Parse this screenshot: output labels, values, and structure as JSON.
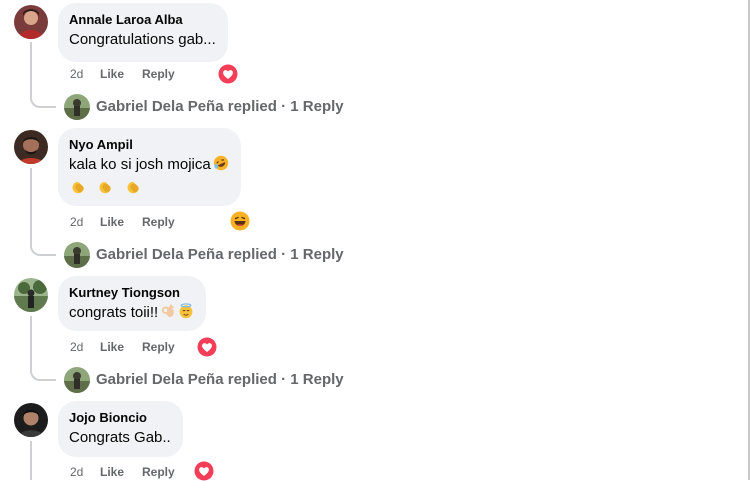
{
  "comments": [
    {
      "author": "Annale Laroa Alba",
      "text": "Congratulations gab...",
      "time": "2d",
      "like_label": "Like",
      "reply_label": "Reply",
      "reaction_icon": "heart-reaction-icon",
      "replies": {
        "author": "Gabriel Dela Peña",
        "replied_label": "replied",
        "separator": "·",
        "count_label": "1 Reply"
      }
    },
    {
      "author": "Nyo Ampil",
      "text": "kala ko si josh mojica",
      "text_emoji_icon": "rolling-laughing-emoji-icon",
      "emoji_line_icons": [
        "clapping-hands-icon",
        "clapping-hands-icon",
        "clapping-hands-icon"
      ],
      "time": "2d",
      "like_label": "Like",
      "reply_label": "Reply",
      "reaction_icon": "haha-reaction-icon",
      "replies": {
        "author": "Gabriel Dela Peña",
        "replied_label": "replied",
        "separator": "·",
        "count_label": "1 Reply"
      }
    },
    {
      "author": "Kurtney Tiongson",
      "text": "congrats toii!!",
      "text_emoji_icons": [
        "ok-hand-emoji-icon",
        "halo-smile-emoji-icon"
      ],
      "time": "2d",
      "like_label": "Like",
      "reply_label": "Reply",
      "reaction_icon": "heart-reaction-icon",
      "replies": {
        "author": "Gabriel Dela Peña",
        "replied_label": "replied",
        "separator": "·",
        "count_label": "1 Reply"
      }
    },
    {
      "author": "Jojo Bioncio",
      "text": "Congrats Gab..",
      "time": "2d",
      "like_label": "Like",
      "reply_label": "Reply",
      "reaction_icon": "heart-reaction-icon"
    }
  ],
  "colors": {
    "bubble": "#f0f2f5",
    "secondary_text": "#65676b",
    "heart": "#f33e58",
    "haha": "#f7b125",
    "thread_line": "#ced0d4"
  }
}
